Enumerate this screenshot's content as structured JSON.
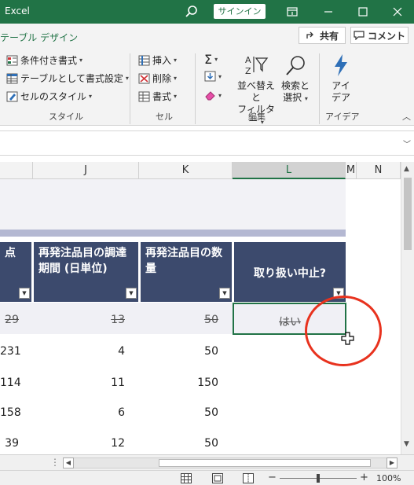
{
  "app": {
    "title": "Excel",
    "signin_label": "サインイン"
  },
  "ribbon": {
    "tab_name": "テーブル デザイン",
    "share_label": "共有",
    "comment_label": "コメント",
    "styles": {
      "conditional": "条件付き書式",
      "as_table": "テーブルとして書式設定",
      "cell_styles": "セルのスタイル",
      "group_label": "スタイル"
    },
    "cells": {
      "insert": "挿入",
      "delete": "削除",
      "format": "書式",
      "group_label": "セル"
    },
    "editing": {
      "sort_filter_line1": "並べ替えと",
      "sort_filter_line2": "フィルター",
      "find_select_line1": "検索と",
      "find_select_line2": "選択",
      "group_label": "編集"
    },
    "ideas": {
      "label_line1": "アイ",
      "label_line2": "デア",
      "group_label": "アイデア"
    }
  },
  "columns": [
    "J",
    "K",
    "L",
    "M",
    "N"
  ],
  "table": {
    "headers": [
      {
        "text": "点"
      },
      {
        "text": "再発注品目の調達期間 (日単位)"
      },
      {
        "text": "再発注品目の数量"
      },
      {
        "text": "取り扱い中止?"
      }
    ],
    "rows": [
      {
        "col0": "29",
        "col1": "13",
        "col2": "50",
        "col3": "はい",
        "discontinued": true
      },
      {
        "col0": "231",
        "col1": "4",
        "col2": "50",
        "col3": ""
      },
      {
        "col0": "114",
        "col1": "11",
        "col2": "150",
        "col3": ""
      },
      {
        "col0": "158",
        "col1": "6",
        "col2": "50",
        "col3": ""
      },
      {
        "col0": "39",
        "col1": "12",
        "col2": "50",
        "col3": ""
      }
    ]
  },
  "status": {
    "zoom": "100%"
  },
  "colors": {
    "excel_green": "#217346",
    "header_navy": "#3c4a6d",
    "annotation_red": "#e8321e"
  }
}
